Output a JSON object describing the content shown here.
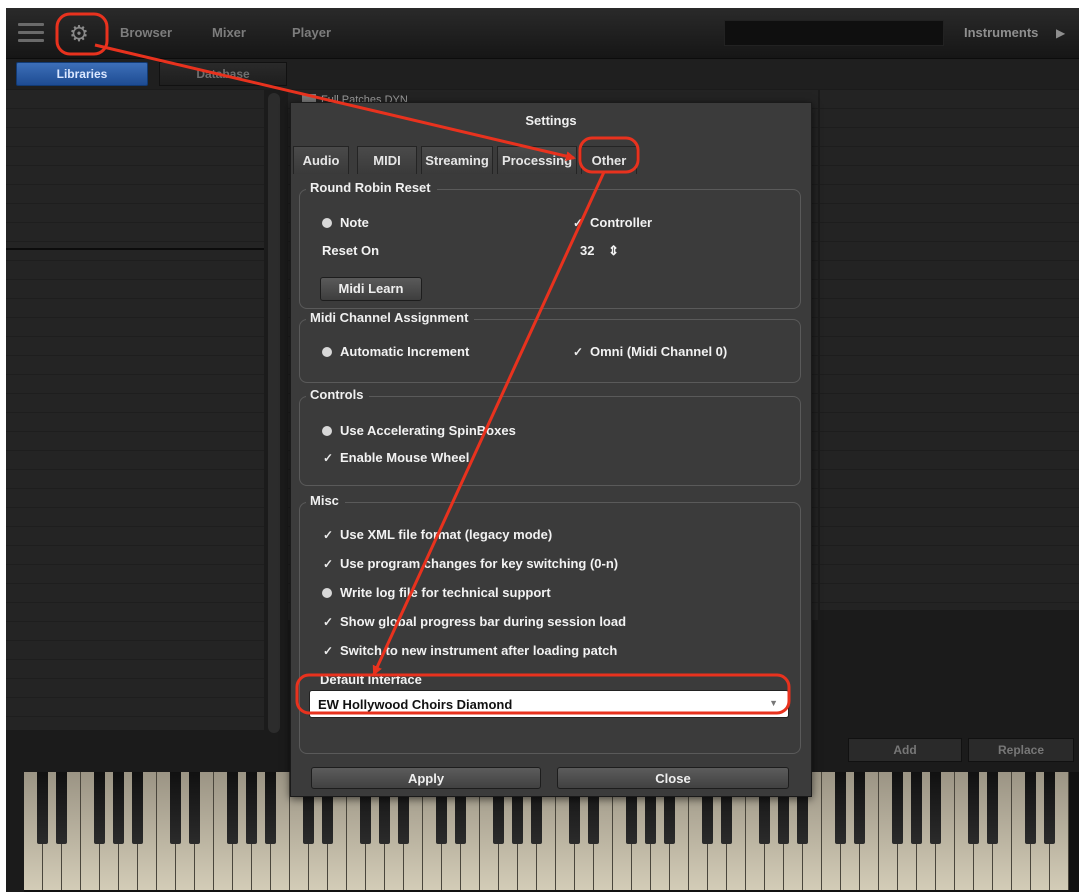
{
  "topbar": {
    "tabs": [
      "Browser",
      "Mixer",
      "Player"
    ],
    "instruments_label": "Instruments",
    "menu_icon": "hamburger-icon",
    "settings_icon": "gear-icon"
  },
  "subtabs": {
    "libraries": "Libraries",
    "database": "Database"
  },
  "browser": {
    "folder_label": "Full Patches DYN"
  },
  "actions": {
    "add": "Add",
    "replace": "Replace"
  },
  "settings": {
    "title": "Settings",
    "tabs": [
      "Audio",
      "MIDI",
      "Streaming",
      "Processing",
      "Other"
    ],
    "active_tab": "Other",
    "round_robin": {
      "title": "Round Robin Reset",
      "note": "Note",
      "controller": "Controller",
      "reset_on_label": "Reset On",
      "reset_on_value": "32",
      "midi_learn": "Midi Learn"
    },
    "midi_channel": {
      "title": "Midi Channel Assignment",
      "automatic": "Automatic Increment",
      "omni": "Omni (Midi Channel 0)"
    },
    "controls": {
      "title": "Controls",
      "accel": "Use Accelerating SpinBoxes",
      "wheel": "Enable Mouse Wheel"
    },
    "misc": {
      "title": "Misc",
      "xml": "Use XML file format (legacy mode)",
      "program_changes": "Use program changes for key switching (0-n)",
      "log": "Write log file for technical support",
      "progress": "Show global progress bar during session load",
      "switch": "Switch to new instrument after loading patch",
      "default_interface_label": "Default Interface",
      "default_interface_value": "EW Hollywood Choirs Diamond"
    },
    "apply": "Apply",
    "close": "Close"
  },
  "colors": {
    "accent_blue": "#2a5ea8",
    "annotation_red": "#e8321e"
  }
}
